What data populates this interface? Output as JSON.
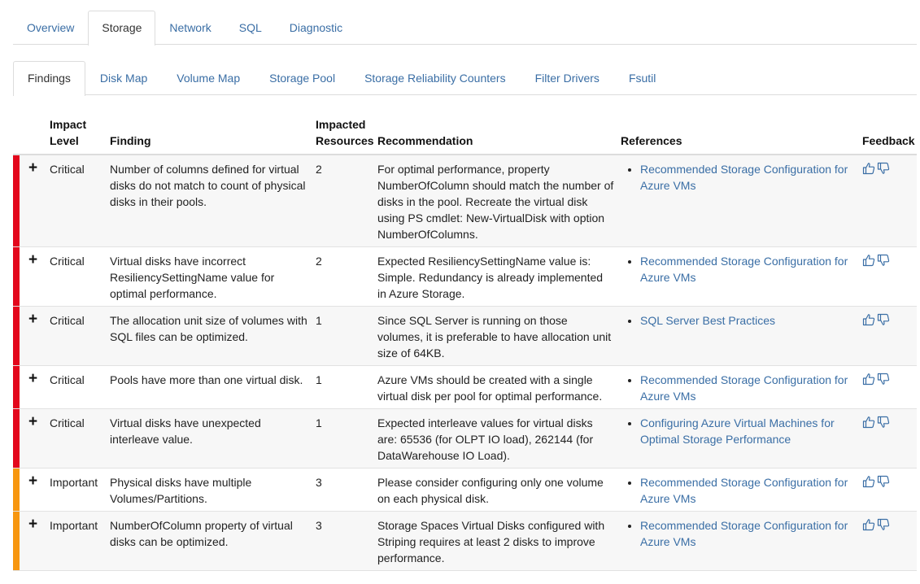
{
  "primary_tabs": [
    {
      "label": "Overview"
    },
    {
      "label": "Storage"
    },
    {
      "label": "Network"
    },
    {
      "label": "SQL"
    },
    {
      "label": "Diagnostic"
    }
  ],
  "primary_active": "Storage",
  "secondary_tabs": [
    {
      "label": "Findings"
    },
    {
      "label": "Disk Map"
    },
    {
      "label": "Volume Map"
    },
    {
      "label": "Storage Pool"
    },
    {
      "label": "Storage Reliability Counters"
    },
    {
      "label": "Filter Drivers"
    },
    {
      "label": "Fsutil"
    }
  ],
  "secondary_active": "Findings",
  "table": {
    "headers": {
      "impact_level": "Impact Level",
      "finding": "Finding",
      "impacted_resources": "Impacted Resources",
      "recommendation": "Recommendation",
      "references": "References",
      "feedback": "Feedback"
    },
    "expand_symbol": "+",
    "colors": {
      "critical": "#e3071c",
      "important": "#f7960f",
      "link": "#3a6ea5"
    },
    "rows": [
      {
        "severity": "critical",
        "impact": "Critical",
        "finding": "Number of columns defined for virtual disks do not match to count of physical disks in their pools.",
        "impacted": "2",
        "recommendation": "For optimal performance, property NumberOfColumn should match the number of disks in the pool. Recreate the virtual disk using PS cmdlet: New-VirtualDisk with option NumberOfColumns.",
        "reference": "Recommended Storage Configuration for Azure VMs"
      },
      {
        "severity": "critical",
        "impact": "Critical",
        "finding": "Virtual disks have incorrect ResiliencySettingName value for optimal performance.",
        "impacted": "2",
        "recommendation": "Expected ResiliencySettingName value is: Simple. Redundancy is already implemented in Azure Storage.",
        "reference": "Recommended Storage Configuration for Azure VMs"
      },
      {
        "severity": "critical",
        "impact": "Critical",
        "finding": "The allocation unit size of volumes with SQL files can be optimized.",
        "impacted": "1",
        "recommendation": "Since SQL Server is running on those volumes, it is preferable to have allocation unit size of 64KB.",
        "reference": "SQL Server Best Practices"
      },
      {
        "severity": "critical",
        "impact": "Critical",
        "finding": "Pools have more than one virtual disk.",
        "impacted": "1",
        "recommendation": "Azure VMs should be created with a single virtual disk per pool for optimal performance.",
        "reference": "Recommended Storage Configuration for Azure VMs"
      },
      {
        "severity": "critical",
        "impact": "Critical",
        "finding": "Virtual disks have unexpected interleave value.",
        "impacted": "1",
        "recommendation": "Expected interleave values for virtual disks are: 65536 (for OLPT IO load), 262144 (for DataWarehouse IO Load).",
        "reference": "Configuring Azure Virtual Machines for Optimal Storage Performance"
      },
      {
        "severity": "important",
        "impact": "Important",
        "finding": "Physical disks have multiple Volumes/Partitions.",
        "impacted": "3",
        "recommendation": "Please consider configuring only one volume on each physical disk.",
        "reference": "Recommended Storage Configuration for Azure VMs"
      },
      {
        "severity": "important",
        "impact": "Important",
        "finding": "NumberOfColumn property of virtual disks can be optimized.",
        "impacted": "3",
        "recommendation": "Storage Spaces Virtual Disks configured with Striping requires at least 2 disks to improve performance.",
        "reference": "Recommended Storage Configuration for Azure VMs"
      }
    ]
  }
}
